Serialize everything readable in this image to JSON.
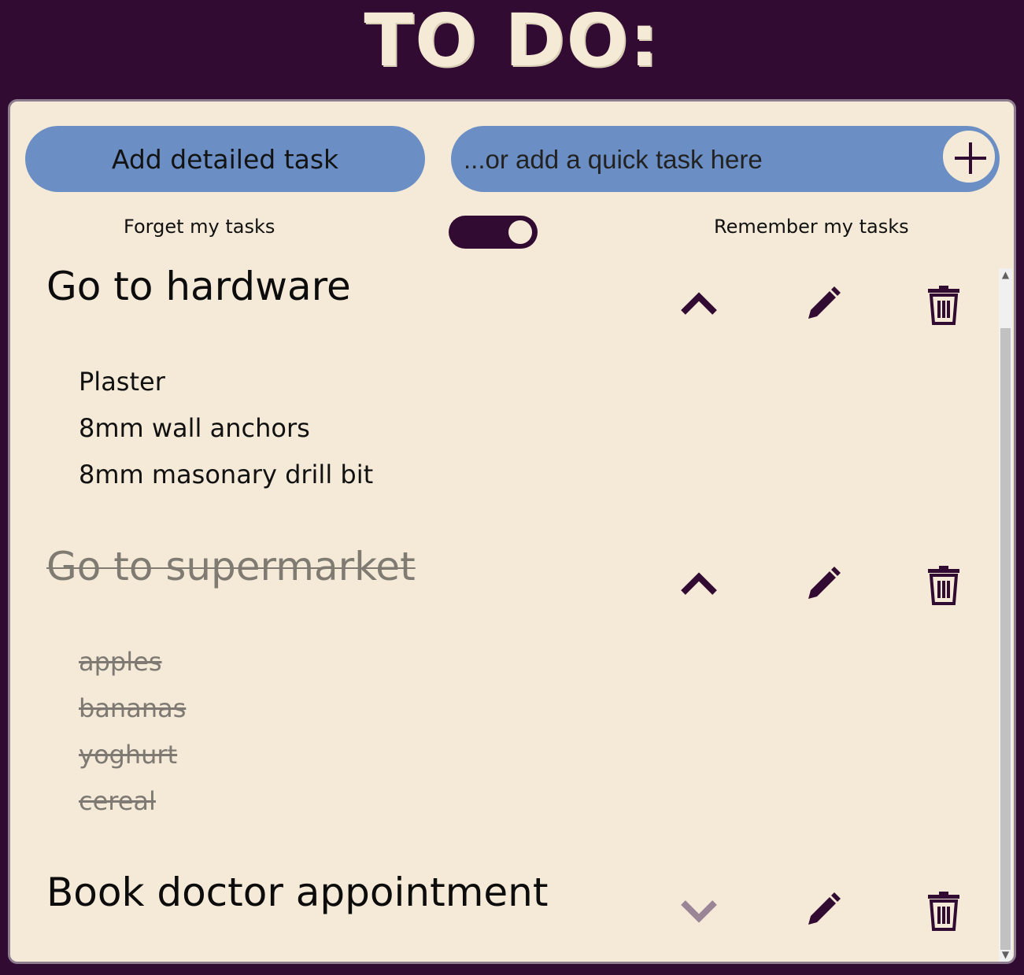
{
  "app": {
    "title": "TO DO:"
  },
  "controls": {
    "detailed_label": "Add detailed task",
    "quick_placeholder": "...or add a quick task here",
    "forget_label": "Forget my tasks",
    "remember_label": "Remember my tasks",
    "remember_enabled": true
  },
  "colors": {
    "background": "#320b33",
    "panel": "#f4ead7",
    "button": "#6b8fc4",
    "accent": "#320b33",
    "completed_text": "#807b72"
  },
  "tasks": [
    {
      "title": "Go to hardware",
      "completed": false,
      "expanded": true,
      "items": [
        "Plaster",
        "8mm wall anchors",
        "8mm masonary drill bit"
      ]
    },
    {
      "title": "Go to supermarket",
      "completed": true,
      "expanded": true,
      "items": [
        "apples",
        "bananas",
        "yoghurt",
        "cereal"
      ]
    },
    {
      "title": "Book doctor appointment",
      "completed": false,
      "expanded": false,
      "items": []
    }
  ],
  "icons": {
    "collapse": "chevron-up-icon",
    "expand": "chevron-down-icon",
    "edit": "pencil-icon",
    "delete": "trash-icon",
    "add": "plus-icon"
  }
}
